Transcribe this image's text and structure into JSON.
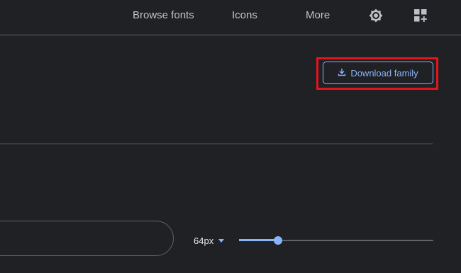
{
  "nav": {
    "browse_fonts": "Browse fonts",
    "icons": "Icons",
    "more": "More",
    "theme_icon": "brightness-icon",
    "apps_icon": "apps-add-icon"
  },
  "actions": {
    "download_label": "Download family",
    "download_icon": "download-icon"
  },
  "preview": {
    "placeholder": ""
  },
  "size": {
    "value": "64px",
    "slider_fraction": 0.2
  },
  "colors": {
    "background": "#202124",
    "accent": "#8ab4f8",
    "text": "#bdc1c6",
    "divider": "#5f6368",
    "highlight": "#e3141c"
  }
}
